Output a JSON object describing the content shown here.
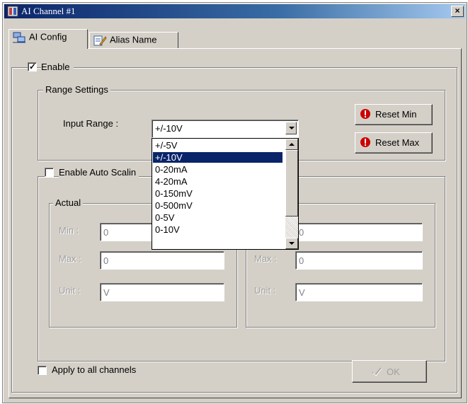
{
  "window": {
    "title": "AI Channel #1",
    "close_symbol": "×"
  },
  "tabs": [
    {
      "label": "AI Config",
      "active": true,
      "icon": "network-config-icon"
    },
    {
      "label": "Alias Name",
      "active": false,
      "icon": "edit-note-icon"
    }
  ],
  "enable": {
    "label": "Enable",
    "checked": true
  },
  "range_settings": {
    "title": "Range Settings",
    "input_range_label": "Input Range :",
    "selected": "+/-10V",
    "reset_min_label": "Reset Min",
    "reset_max_label": "Reset Max",
    "options": [
      "+/-5V",
      "+/-10V",
      "0-20mA",
      "4-20mA",
      "0-150mV",
      "0-500mV",
      "0-5V",
      "0-10V"
    ],
    "selected_index": 1
  },
  "auto_scaling": {
    "label": "Enable Auto Scalin",
    "checked": false,
    "actual": {
      "title": "Actual",
      "min_label": "Min :",
      "min_value": "0",
      "max_label": "Max :",
      "max_value": "0",
      "unit_label": "Unit :",
      "unit_value": "V"
    },
    "scaled": {
      "min_value": "0",
      "max_label": "Max :",
      "max_value": "0",
      "unit_label": "Unit :",
      "unit_value": "V"
    }
  },
  "apply_all": {
    "label": "Apply to all channels",
    "checked": false
  },
  "ok_button": {
    "label": "OK",
    "enabled": false
  },
  "colors": {
    "title_bar": "#0a246a",
    "dialog_bg": "#d4d0c8",
    "selection": "#0a246a",
    "reset_icon": "#cc0000"
  }
}
